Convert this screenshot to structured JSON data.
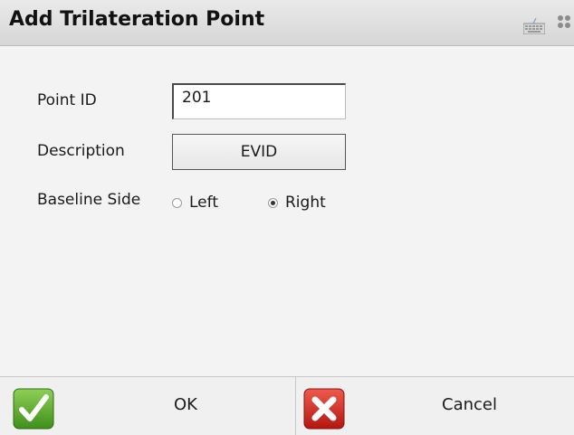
{
  "window": {
    "title": "Add Trilateration Point"
  },
  "form": {
    "point_id": {
      "label": "Point ID",
      "value": "201"
    },
    "description": {
      "label": "Description",
      "value": "EVID"
    },
    "baseline_side": {
      "label": "Baseline Side",
      "options": [
        {
          "label": "Left",
          "selected": false
        },
        {
          "label": "Right",
          "selected": true
        }
      ]
    }
  },
  "buttons": {
    "ok_label": "OK",
    "cancel_label": "Cancel"
  },
  "icons": {
    "keyboard": "keyboard-icon",
    "grip": "grip-icon",
    "ok": "check-icon",
    "cancel": "close-x-icon"
  },
  "colors": {
    "ok_green": "#5aa52c",
    "cancel_red": "#cc2a22"
  }
}
